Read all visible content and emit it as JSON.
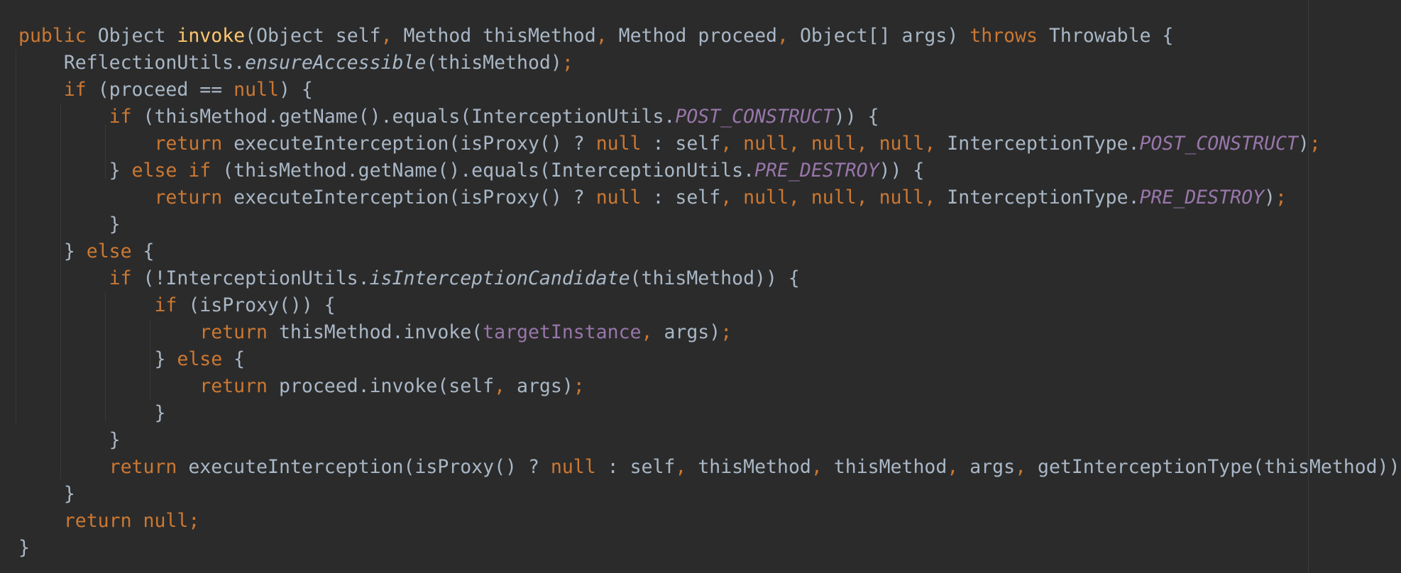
{
  "colors": {
    "background": "#2b2b2b",
    "default_text": "#a9b7c6",
    "keyword": "#cc7832",
    "method_declaration": "#ffc66d",
    "static_constant": "#9876aa",
    "instance_field": "#9876aa"
  },
  "code_lines": [
    [
      [
        "kw",
        "public "
      ],
      [
        "t",
        "Object "
      ],
      [
        "fn",
        "invoke"
      ],
      [
        "t",
        "(Object self"
      ],
      [
        "kw",
        ", "
      ],
      [
        "t",
        "Method thisMethod"
      ],
      [
        "kw",
        ", "
      ],
      [
        "t",
        "Method proceed"
      ],
      [
        "kw",
        ", "
      ],
      [
        "t",
        "Object[] args) "
      ],
      [
        "kw",
        "throws "
      ],
      [
        "t",
        "Throwable {"
      ]
    ],
    [
      [
        "t",
        "    ReflectionUtils."
      ],
      [
        "it",
        "ensureAccessible"
      ],
      [
        "t",
        "(thisMethod)"
      ],
      [
        "kw",
        ";"
      ]
    ],
    [
      [
        "kw",
        "    if "
      ],
      [
        "t",
        "(proceed == "
      ],
      [
        "kw",
        "null"
      ],
      [
        "t",
        ") {"
      ]
    ],
    [
      [
        "kw",
        "        if "
      ],
      [
        "t",
        "(thisMethod.getName().equals(InterceptionUtils."
      ],
      [
        "st",
        "POST_CONSTRUCT"
      ],
      [
        "t",
        ")) {"
      ]
    ],
    [
      [
        "kw",
        "            return "
      ],
      [
        "t",
        "executeInterception(isProxy() ? "
      ],
      [
        "kw",
        "null "
      ],
      [
        "t",
        ": self"
      ],
      [
        "kw",
        ", null, null, null, "
      ],
      [
        "t",
        "InterceptionType."
      ],
      [
        "st",
        "POST_CONSTRUCT"
      ],
      [
        "t",
        ")"
      ],
      [
        "kw",
        ";"
      ]
    ],
    [
      [
        "t",
        "        } "
      ],
      [
        "kw",
        "else if "
      ],
      [
        "t",
        "(thisMethod.getName().equals(InterceptionUtils."
      ],
      [
        "st",
        "PRE_DESTROY"
      ],
      [
        "t",
        ")) {"
      ]
    ],
    [
      [
        "kw",
        "            return "
      ],
      [
        "t",
        "executeInterception(isProxy() ? "
      ],
      [
        "kw",
        "null "
      ],
      [
        "t",
        ": self"
      ],
      [
        "kw",
        ", null, null, null, "
      ],
      [
        "t",
        "InterceptionType."
      ],
      [
        "st",
        "PRE_DESTROY"
      ],
      [
        "t",
        ")"
      ],
      [
        "kw",
        ";"
      ]
    ],
    [
      [
        "t",
        "        }"
      ]
    ],
    [
      [
        "t",
        "    } "
      ],
      [
        "kw",
        "else "
      ],
      [
        "t",
        "{"
      ]
    ],
    [
      [
        "kw",
        "        if "
      ],
      [
        "t",
        "(!InterceptionUtils."
      ],
      [
        "it",
        "isInterceptionCandidate"
      ],
      [
        "t",
        "(thisMethod)) {"
      ]
    ],
    [
      [
        "kw",
        "            if "
      ],
      [
        "t",
        "(isProxy()) {"
      ]
    ],
    [
      [
        "kw",
        "                return "
      ],
      [
        "t",
        "thisMethod.invoke("
      ],
      [
        "fl",
        "targetInstance"
      ],
      [
        "kw",
        ", "
      ],
      [
        "t",
        "args)"
      ],
      [
        "kw",
        ";"
      ]
    ],
    [
      [
        "t",
        "            } "
      ],
      [
        "kw",
        "else "
      ],
      [
        "t",
        "{"
      ]
    ],
    [
      [
        "kw",
        "                return "
      ],
      [
        "t",
        "proceed.invoke(self"
      ],
      [
        "kw",
        ", "
      ],
      [
        "t",
        "args)"
      ],
      [
        "kw",
        ";"
      ]
    ],
    [
      [
        "t",
        "            }"
      ]
    ],
    [
      [
        "t",
        "        }"
      ]
    ],
    [
      [
        "kw",
        "        return "
      ],
      [
        "t",
        "executeInterception(isProxy() ? "
      ],
      [
        "kw",
        "null "
      ],
      [
        "t",
        ": self"
      ],
      [
        "kw",
        ", "
      ],
      [
        "t",
        "thisMethod"
      ],
      [
        "kw",
        ", "
      ],
      [
        "t",
        "thisMethod"
      ],
      [
        "kw",
        ", "
      ],
      [
        "t",
        "args"
      ],
      [
        "kw",
        ", "
      ],
      [
        "t",
        "getInterceptionType(thisMethod))"
      ],
      [
        "kw",
        ";"
      ]
    ],
    [
      [
        "t",
        "    }"
      ]
    ],
    [
      [
        "kw",
        "    return null;"
      ]
    ],
    [
      [
        "t",
        "}"
      ]
    ]
  ]
}
